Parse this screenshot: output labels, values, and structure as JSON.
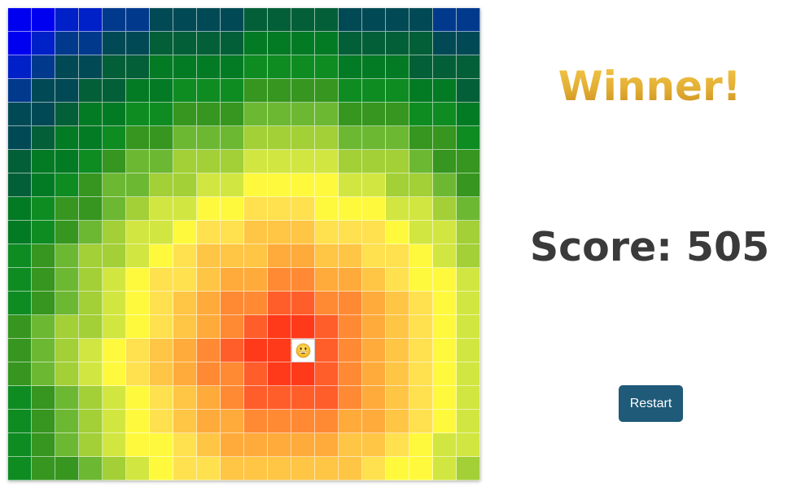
{
  "game": {
    "board_rows": 20,
    "board_cols": 20,
    "player_cell": {
      "row": 14,
      "col": 12
    },
    "player_icon": "grinning-face-icon",
    "heat_center": {
      "row": 14.3,
      "col": 11.4
    },
    "heat_palette": [
      "#f20f0f",
      "#ff3a1a",
      "#ff5e2b",
      "#ff8a33",
      "#ffab3b",
      "#ffc545",
      "#ffe04f",
      "#fff93e",
      "#d2e641",
      "#a3cf37",
      "#6db833",
      "#36961f",
      "#0e8c22",
      "#037a24",
      "#035f37",
      "#014a55",
      "#013a8c",
      "#0020c8",
      "#0000f0",
      "#0000ff"
    ]
  },
  "panel": {
    "winner_text": "Winner!",
    "score_text": "Score: 505",
    "restart_label": "Restart"
  }
}
